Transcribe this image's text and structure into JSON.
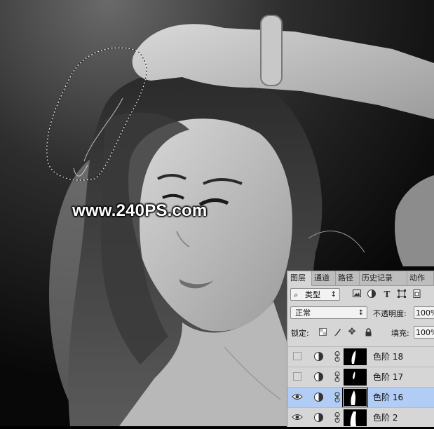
{
  "canvas": {
    "watermark": "www.240PS.com"
  },
  "layers_panel": {
    "tabs": [
      {
        "label": "图层",
        "active": true
      },
      {
        "label": "通道",
        "active": false
      },
      {
        "label": "路径",
        "active": false
      },
      {
        "label": "历史记录",
        "active": false
      },
      {
        "label": "动作",
        "active": false
      }
    ],
    "filter": {
      "search_glyph": "⌕",
      "kind_label": "类型",
      "spinner": "↕",
      "icons": [
        "image-filter-icon",
        "adjustment-filter-icon",
        "type-filter-icon",
        "shape-filter-icon",
        "smart-object-filter-icon"
      ]
    },
    "blend": {
      "mode": "正常",
      "opacity_label": "不透明度:",
      "opacity_value": "100%"
    },
    "lock": {
      "label": "锁定:",
      "fill_label": "填充:",
      "fill_value": "100%"
    },
    "layers": [
      {
        "name": "色阶",
        "number": "18",
        "visible": false,
        "selected": false
      },
      {
        "name": "色阶",
        "number": "17",
        "visible": false,
        "selected": false
      },
      {
        "name": "色阶",
        "number": "16",
        "visible": true,
        "selected": true
      },
      {
        "name": "色阶",
        "number": "2",
        "visible": true,
        "selected": false
      }
    ]
  }
}
